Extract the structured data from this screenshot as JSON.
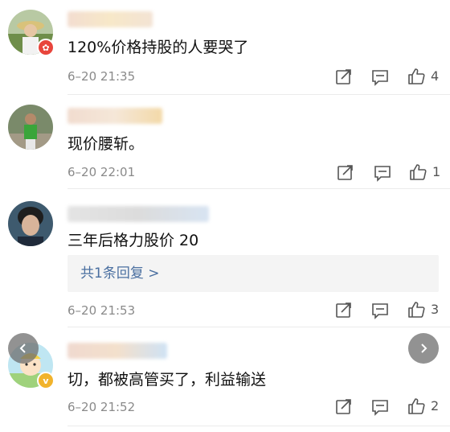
{
  "comments": [
    {
      "text": "120%价格持股的人要哭了",
      "time": "6–20 21:35",
      "likes": "4",
      "reply": null
    },
    {
      "text": "现价腰斩。",
      "time": "6–20 22:01",
      "likes": "1",
      "reply": null
    },
    {
      "text": "三年后格力股价 20",
      "time": "6–20 21:53",
      "likes": "3",
      "reply": "共1条回复 >"
    },
    {
      "text": "切，都被高管买了，利益输送",
      "time": "6–20 21:52",
      "likes": "2",
      "reply": null
    }
  ],
  "icons": {
    "share": "share-icon",
    "comment": "comment-icon",
    "like": "thumbs-up-icon",
    "prev": "chevron-left-icon",
    "next": "chevron-right-icon"
  },
  "colors": {
    "link": "#4a6fa0",
    "meta": "#8a8a8a",
    "badge_red": "#e8453c",
    "badge_gold": "#f1b32c"
  }
}
